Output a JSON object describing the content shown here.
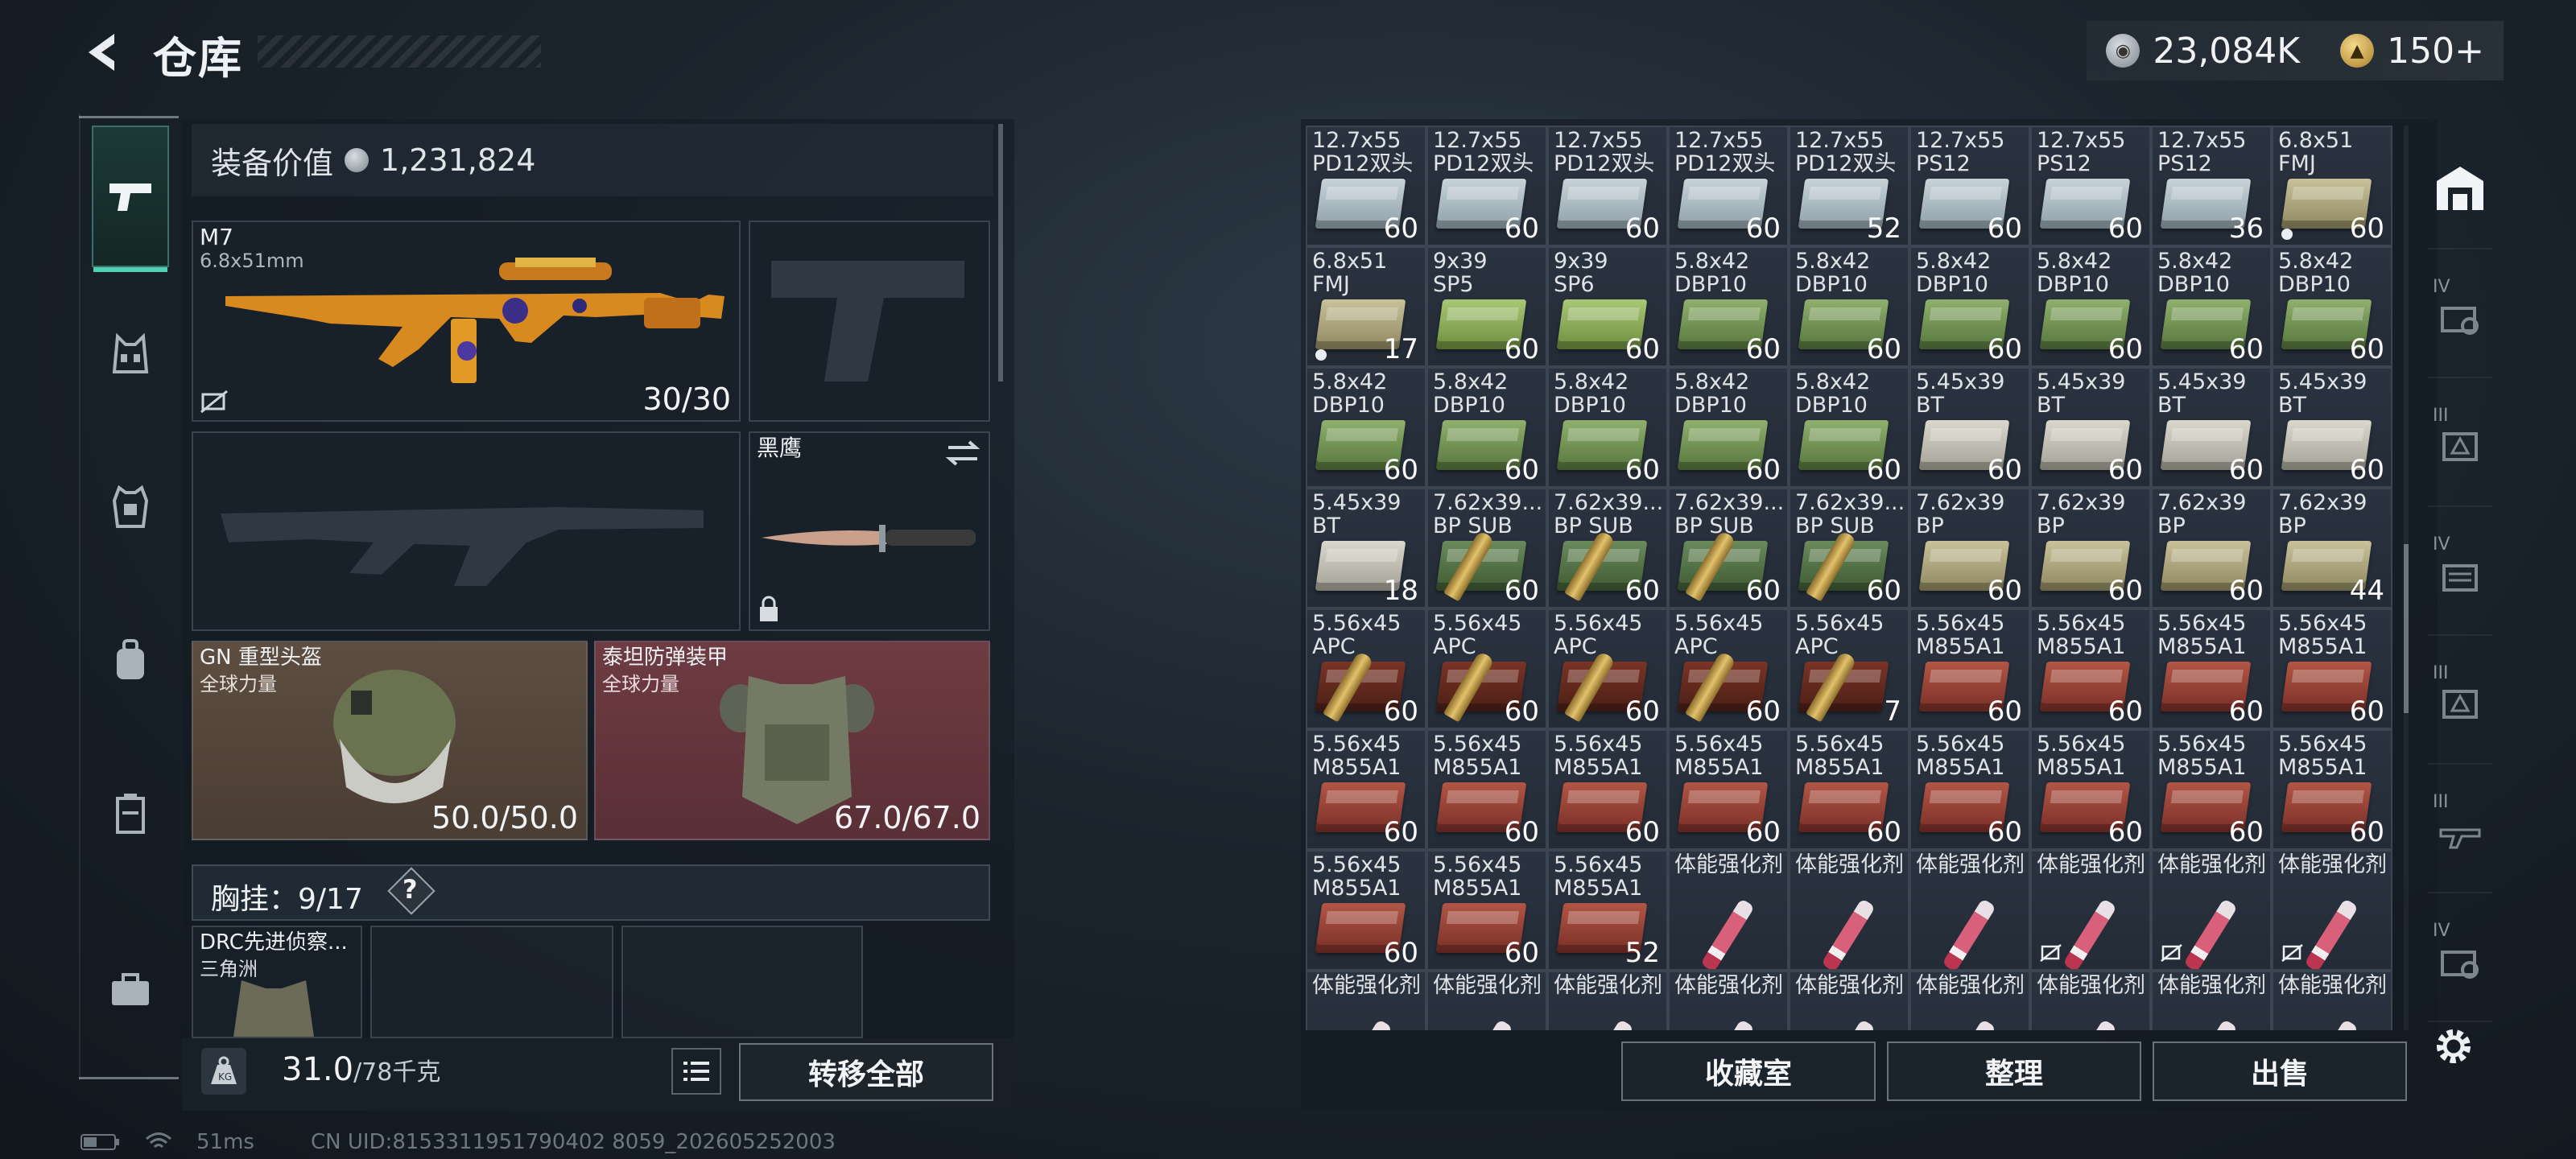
{
  "header": {
    "title": "仓库",
    "currency_silver": "23,084K",
    "currency_gold": "150+"
  },
  "loadout": {
    "value_label": "装备价值",
    "value": "1,231,824",
    "primary": {
      "name": "M7",
      "caliber": "6.8x51mm",
      "ammo": "30/30"
    },
    "melee": {
      "name": "黑鹰"
    },
    "helmet": {
      "name": "GN 重型头盔",
      "sub": "全球力量",
      "durability": "50.0/50.0"
    },
    "armor": {
      "name": "泰坦防弹装甲",
      "sub": "全球力量",
      "durability": "67.0/67.0"
    },
    "chest_rig_label": "胸挂：9/17",
    "chest_rig_help": "?",
    "backpack_slot": {
      "name": "DRC先进侦察...",
      "sub": "三角洲"
    },
    "weight": "31.0",
    "weight_max": "/78千克",
    "transfer_all": "转移全部"
  },
  "grid": {
    "rows": [
      [
        [
          "12.7x55\nPD12双头",
          "60",
          "steel"
        ],
        [
          "12.7x55\nPD12双头",
          "60",
          "steel"
        ],
        [
          "12.7x55\nPD12双头",
          "60",
          "steel"
        ],
        [
          "12.7x55\nPD12双头",
          "60",
          "steel"
        ],
        [
          "12.7x55\nPD12双头",
          "52",
          "steel"
        ],
        [
          "12.7x55\nPS12",
          "60",
          "steel"
        ],
        [
          "12.7x55\nPS12",
          "60",
          "steel"
        ],
        [
          "12.7x55\nPS12",
          "36",
          "steel"
        ],
        [
          "6.8x51\nFMJ",
          "60",
          "khaki"
        ]
      ],
      [
        [
          "6.8x51\nFMJ",
          "17",
          "khaki"
        ],
        [
          "9x39\nSP5",
          "60",
          "lime"
        ],
        [
          "9x39\nSP6",
          "60",
          "lime"
        ],
        [
          "5.8x42\nDBP10",
          "60",
          "green"
        ],
        [
          "5.8x42\nDBP10",
          "60",
          "green"
        ],
        [
          "5.8x42\nDBP10",
          "60",
          "green"
        ],
        [
          "5.8x42\nDBP10",
          "60",
          "green"
        ],
        [
          "5.8x42\nDBP10",
          "60",
          "green"
        ],
        [
          "5.8x42\nDBP10",
          "60",
          "green"
        ]
      ],
      [
        [
          "5.8x42\nDBP10",
          "60",
          "green"
        ],
        [
          "5.8x42\nDBP10",
          "60",
          "green"
        ],
        [
          "5.8x42\nDBP10",
          "60",
          "green"
        ],
        [
          "5.8x42\nDBP10",
          "60",
          "green"
        ],
        [
          "5.8x42\nDBP10",
          "60",
          "green"
        ],
        [
          "5.45x39\nBT",
          "60",
          "pale"
        ],
        [
          "5.45x39\nBT",
          "60",
          "pale"
        ],
        [
          "5.45x39\nBT",
          "60",
          "pale"
        ],
        [
          "5.45x39\nBT",
          "60",
          "pale"
        ]
      ],
      [
        [
          "5.45x39\nBT",
          "18",
          "pale"
        ],
        [
          "7.62x39...\nBP SUB",
          "60",
          "bullets"
        ],
        [
          "7.62x39...\nBP SUB",
          "60",
          "bullets"
        ],
        [
          "7.62x39...\nBP SUB",
          "60",
          "bullets"
        ],
        [
          "7.62x39...\nBP SUB",
          "60",
          "bullets"
        ],
        [
          "7.62x39\nBP",
          "60",
          "khaki"
        ],
        [
          "7.62x39\nBP",
          "60",
          "khaki"
        ],
        [
          "7.62x39\nBP",
          "60",
          "khaki"
        ],
        [
          "7.62x39\nBP",
          "44",
          "khaki"
        ]
      ],
      [
        [
          "5.56x45\nAPC",
          "60",
          "bullets"
        ],
        [
          "5.56x45\nAPC",
          "60",
          "bullets"
        ],
        [
          "5.56x45\nAPC",
          "60",
          "bullets"
        ],
        [
          "5.56x45\nAPC",
          "60",
          "bullets"
        ],
        [
          "5.56x45\nAPC",
          "7",
          "bullets"
        ],
        [
          "5.56x45\nM855A1",
          "60",
          "red"
        ],
        [
          "5.56x45\nM855A1",
          "60",
          "red"
        ],
        [
          "5.56x45\nM855A1",
          "60",
          "red"
        ],
        [
          "5.56x45\nM855A1",
          "60",
          "red"
        ]
      ],
      [
        [
          "5.56x45\nM855A1",
          "60",
          "red"
        ],
        [
          "5.56x45\nM855A1",
          "60",
          "red"
        ],
        [
          "5.56x45\nM855A1",
          "60",
          "red"
        ],
        [
          "5.56x45\nM855A1",
          "60",
          "red"
        ],
        [
          "5.56x45\nM855A1",
          "60",
          "red"
        ],
        [
          "5.56x45\nM855A1",
          "60",
          "red"
        ],
        [
          "5.56x45\nM855A1",
          "60",
          "red"
        ],
        [
          "5.56x45\nM855A1",
          "60",
          "red"
        ],
        [
          "5.56x45\nM855A1",
          "60",
          "red"
        ]
      ],
      [
        [
          "5.56x45\nM855A1",
          "60",
          "red"
        ],
        [
          "5.56x45\nM855A1",
          "60",
          "red"
        ],
        [
          "5.56x45\nM855A1",
          "52",
          "red"
        ],
        [
          "体能强化剂",
          "",
          "syringe"
        ],
        [
          "体能强化剂",
          "",
          "syringe"
        ],
        [
          "体能强化剂",
          "",
          "syringe"
        ],
        [
          "体能强化剂",
          "",
          "syringe-x"
        ],
        [
          "体能强化剂",
          "",
          "syringe-x"
        ],
        [
          "体能强化剂",
          "",
          "syringe-x"
        ]
      ],
      [
        [
          "体能强化剂",
          "",
          "syringe"
        ],
        [
          "体能强化剂",
          "",
          "syringe"
        ],
        [
          "体能强化剂",
          "",
          "syringe"
        ],
        [
          "体能强化剂",
          "",
          "syringe"
        ],
        [
          "体能强化剂",
          "",
          "syringe"
        ],
        [
          "体能强化剂",
          "",
          "syringe"
        ],
        [
          "体能强化剂",
          "",
          "syringe"
        ],
        [
          "体能强化剂",
          "",
          "syringe"
        ],
        [
          "体能强化剂",
          "",
          "syringe"
        ]
      ]
    ]
  },
  "buttons": {
    "collection": "收藏室",
    "sort": "整理",
    "sell": "出售"
  },
  "right_nav": {
    "tiers": [
      "IV",
      "III",
      "IV",
      "III",
      "III",
      "IV"
    ]
  },
  "status": {
    "ping": "51ms",
    "uid": "CN UID:8153311951790402 8059_202605252003"
  },
  "colors": {
    "accent": "#4fd0b0",
    "helmet_bg": "#5a4a3e",
    "armor_bg": "#6a3a3f"
  }
}
